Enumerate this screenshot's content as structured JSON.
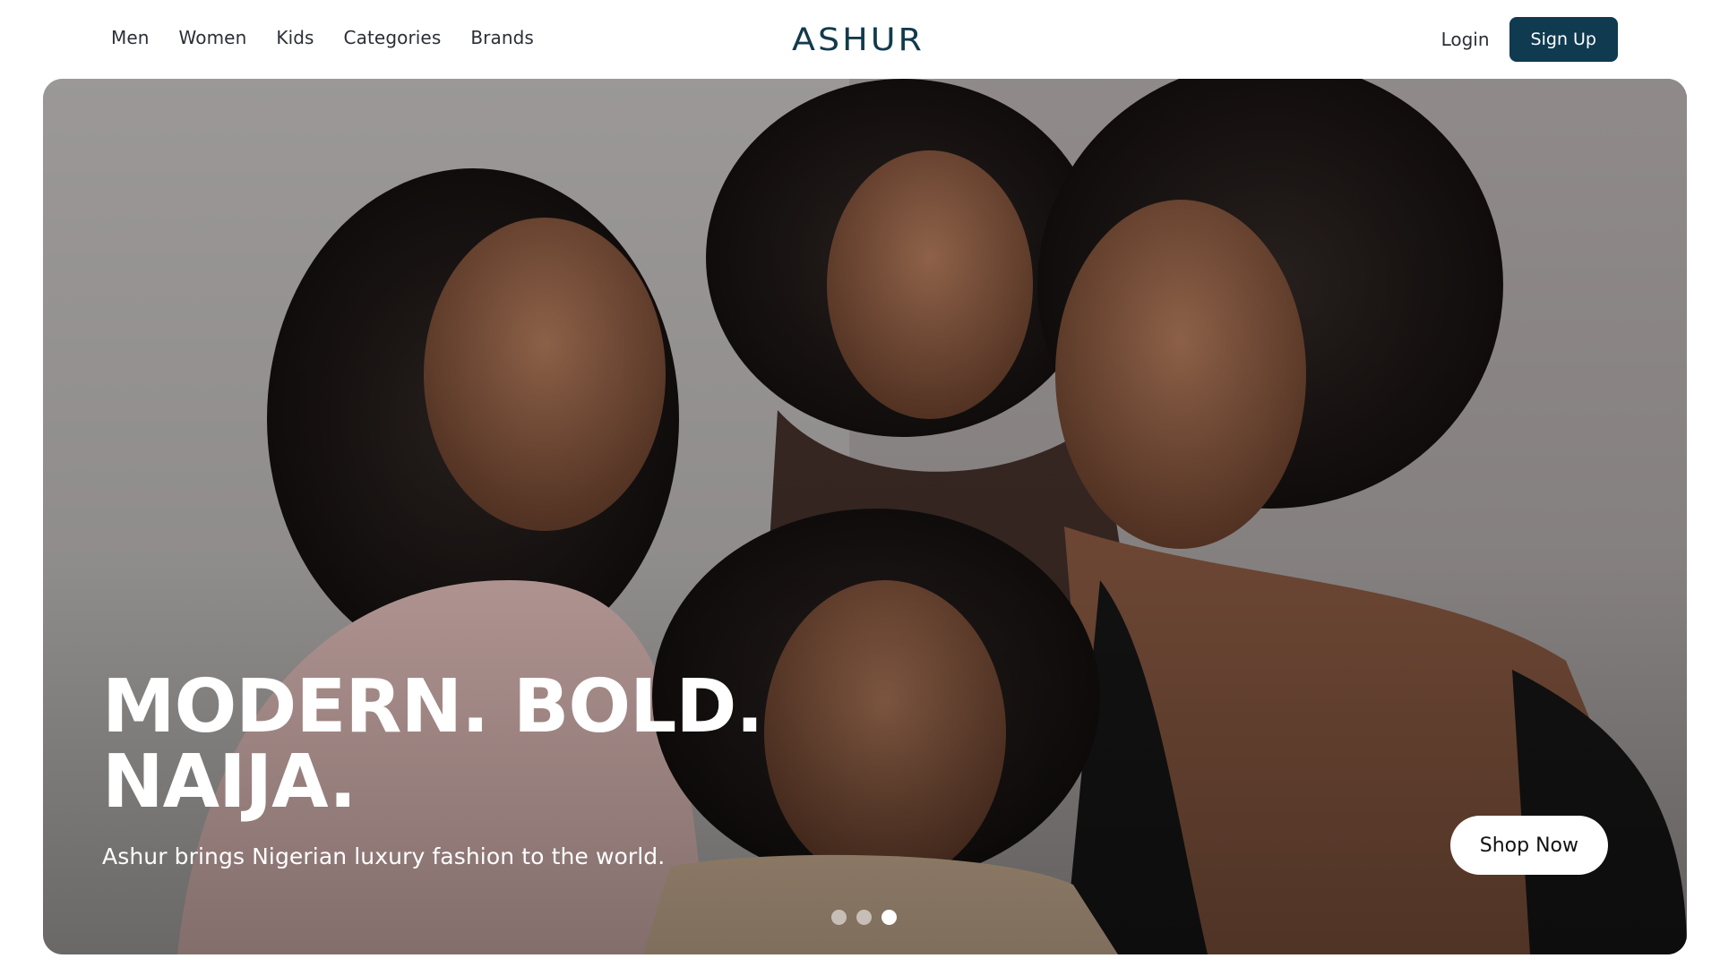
{
  "header": {
    "nav_links": [
      {
        "label": "Men"
      },
      {
        "label": "Women"
      },
      {
        "label": "Kids"
      },
      {
        "label": "Categories"
      },
      {
        "label": "Brands"
      }
    ],
    "logo_text": "ASHUR",
    "login_label": "Login",
    "signup_label": "Sign Up"
  },
  "hero": {
    "headline_line1": "MODERN. BOLD.",
    "headline_line2": "NAIJA.",
    "subtitle": "Ashur brings Nigerian luxury fashion to the world.",
    "cta_label": "Shop Now",
    "carousel": {
      "slide_count": 3,
      "active_index": 2
    }
  },
  "colors": {
    "brand": "#0f3a4f",
    "logo": "#123a4d",
    "hero_text": "#ffffff",
    "cta_background": "#ffffff"
  }
}
